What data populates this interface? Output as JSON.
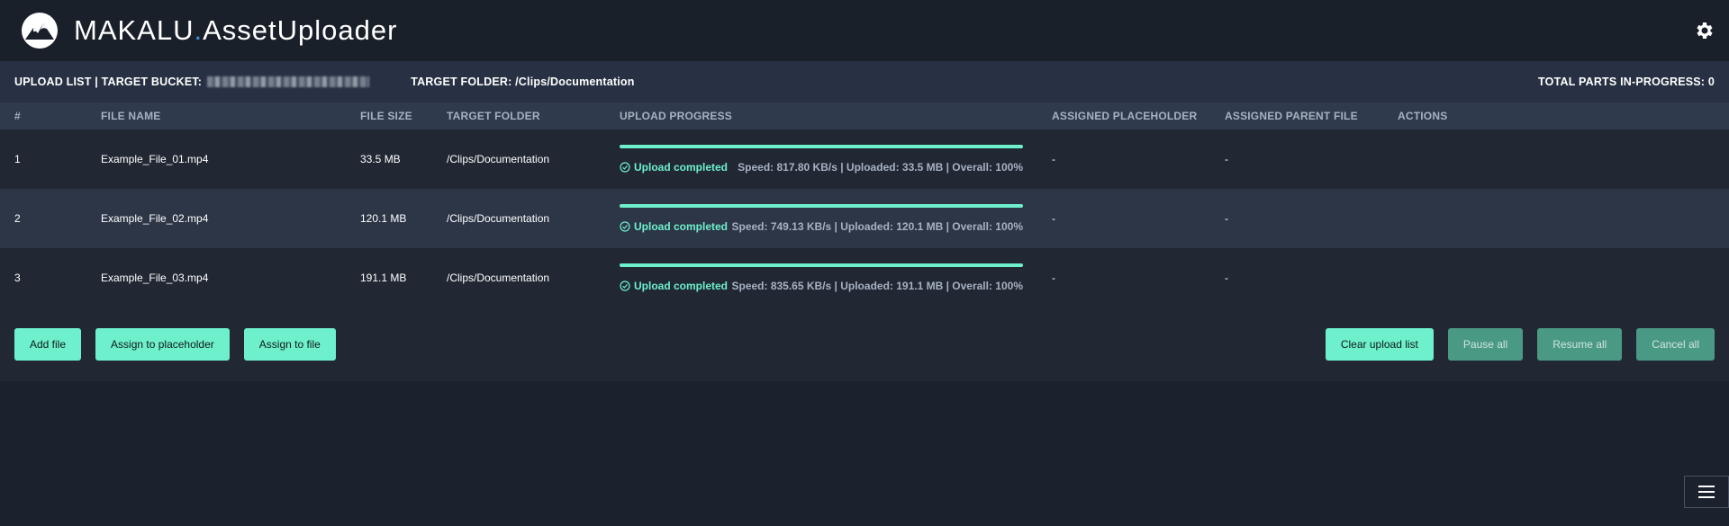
{
  "app": {
    "brand_name": "MAKALU",
    "brand_dot": ".",
    "brand_product": "AssetUploader"
  },
  "subbar": {
    "upload_list_label": "UPLOAD LIST | TARGET BUCKET:",
    "target_folder_label": "TARGET FOLDER: /Clips/Documentation",
    "total_parts_label": "TOTAL PARTS IN-PROGRESS: 0"
  },
  "table": {
    "headers": [
      "#",
      "FILE NAME",
      "FILE SIZE",
      "TARGET FOLDER",
      "UPLOAD PROGRESS",
      "ASSIGNED PLACEHOLDER",
      "ASSIGNED PARENT FILE",
      "ACTIONS"
    ],
    "rows": [
      {
        "index": "1",
        "file_name": "Example_File_01.mp4",
        "file_size": "33.5 MB",
        "target_folder": "/Clips/Documentation",
        "progress": 1.0,
        "status": "Upload completed",
        "stats": "Speed: 817.80 KB/s | Uploaded: 33.5 MB | Overall: 100%",
        "placeholder": "-",
        "parent_file": "-",
        "actions": ""
      },
      {
        "index": "2",
        "file_name": "Example_File_02.mp4",
        "file_size": "120.1 MB",
        "target_folder": "/Clips/Documentation",
        "progress": 1.0,
        "status": "Upload completed",
        "stats": "Speed: 749.13 KB/s | Uploaded: 120.1 MB | Overall: 100%",
        "placeholder": "-",
        "parent_file": "-",
        "actions": ""
      },
      {
        "index": "3",
        "file_name": "Example_File_03.mp4",
        "file_size": "191.1 MB",
        "target_folder": "/Clips/Documentation",
        "progress": 1.0,
        "status": "Upload completed",
        "stats": "Speed: 835.65 KB/s | Uploaded: 191.1 MB | Overall: 100%",
        "placeholder": "-",
        "parent_file": "-",
        "actions": ""
      }
    ]
  },
  "buttons": {
    "add_file": "Add file",
    "assign_placeholder": "Assign to placeholder",
    "assign_file": "Assign to file",
    "clear_list": "Clear upload list",
    "pause_all": "Pause all",
    "resume_all": "Resume all",
    "cancel_all": "Cancel all"
  },
  "icons": {
    "logo": "mountain-logo-icon",
    "settings": "gear-icon",
    "status": "check-circle-icon",
    "menu": "hamburger-menu-icon"
  },
  "colors": {
    "accent": "#6ef0cc",
    "brand_dot": "#3d8fe0",
    "muted_button": "#4a9985"
  }
}
